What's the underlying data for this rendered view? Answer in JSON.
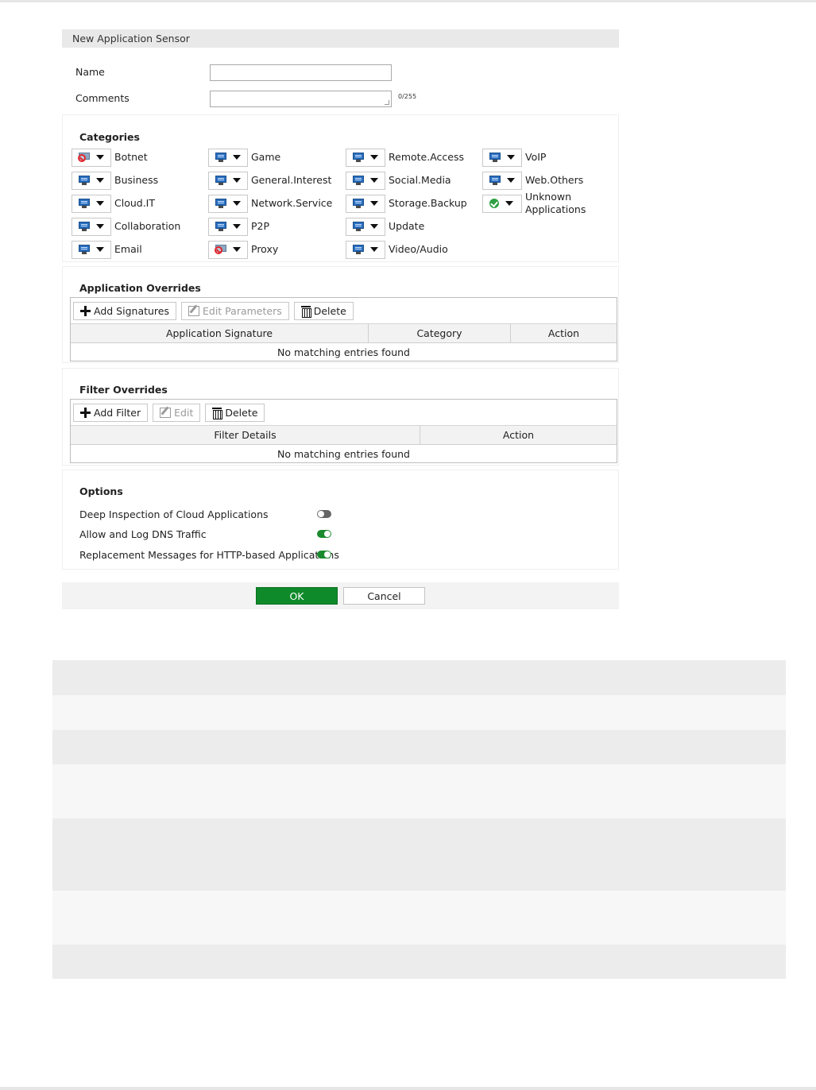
{
  "dialog": {
    "title": "New Application Sensor",
    "name_label": "Name",
    "name_value": "",
    "comments_label": "Comments",
    "comments_value": "",
    "comments_counter": "0/255"
  },
  "categories": {
    "title": "Categories",
    "items": [
      {
        "label": "Botnet",
        "icon": "block-icon"
      },
      {
        "label": "Business",
        "icon": "monitor-icon"
      },
      {
        "label": "Cloud.IT",
        "icon": "monitor-icon"
      },
      {
        "label": "Collaboration",
        "icon": "monitor-icon"
      },
      {
        "label": "Email",
        "icon": "monitor-icon"
      },
      {
        "label": "Game",
        "icon": "monitor-icon"
      },
      {
        "label": "General.Interest",
        "icon": "monitor-icon"
      },
      {
        "label": "Network.Service",
        "icon": "monitor-icon"
      },
      {
        "label": "P2P",
        "icon": "monitor-icon"
      },
      {
        "label": "Proxy",
        "icon": "block-icon"
      },
      {
        "label": "Remote.Access",
        "icon": "monitor-icon"
      },
      {
        "label": "Social.Media",
        "icon": "monitor-icon"
      },
      {
        "label": "Storage.Backup",
        "icon": "monitor-icon"
      },
      {
        "label": "Update",
        "icon": "monitor-icon"
      },
      {
        "label": "Video/Audio",
        "icon": "monitor-icon"
      },
      {
        "label": "VoIP",
        "icon": "monitor-icon"
      },
      {
        "label": "Web.Others",
        "icon": "monitor-icon"
      },
      {
        "label": "Unknown Applications",
        "icon": "check-icon"
      }
    ]
  },
  "app_overrides": {
    "title": "Application Overrides",
    "add_label": "Add Signatures",
    "edit_label": "Edit Parameters",
    "delete_label": "Delete",
    "columns": [
      "Application Signature",
      "Category",
      "Action"
    ],
    "empty_text": "No matching entries found"
  },
  "filter_overrides": {
    "title": "Filter Overrides",
    "add_label": "Add Filter",
    "edit_label": "Edit",
    "delete_label": "Delete",
    "columns": [
      "Filter Details",
      "Action"
    ],
    "empty_text": "No matching entries found"
  },
  "options": {
    "title": "Options",
    "items": [
      {
        "label": "Deep Inspection of Cloud Applications",
        "enabled": false
      },
      {
        "label": "Allow and Log DNS Traffic",
        "enabled": true
      },
      {
        "label": "Replacement Messages for HTTP-based Applications",
        "enabled": true
      }
    ]
  },
  "buttons": {
    "ok_label": "OK",
    "cancel_label": "Cancel"
  },
  "colors": {
    "ok_green": "#0f8a2a",
    "toggle_on": "#1b8a2e",
    "toggle_off": "#666666",
    "header_gray": "#e9e9e9"
  }
}
